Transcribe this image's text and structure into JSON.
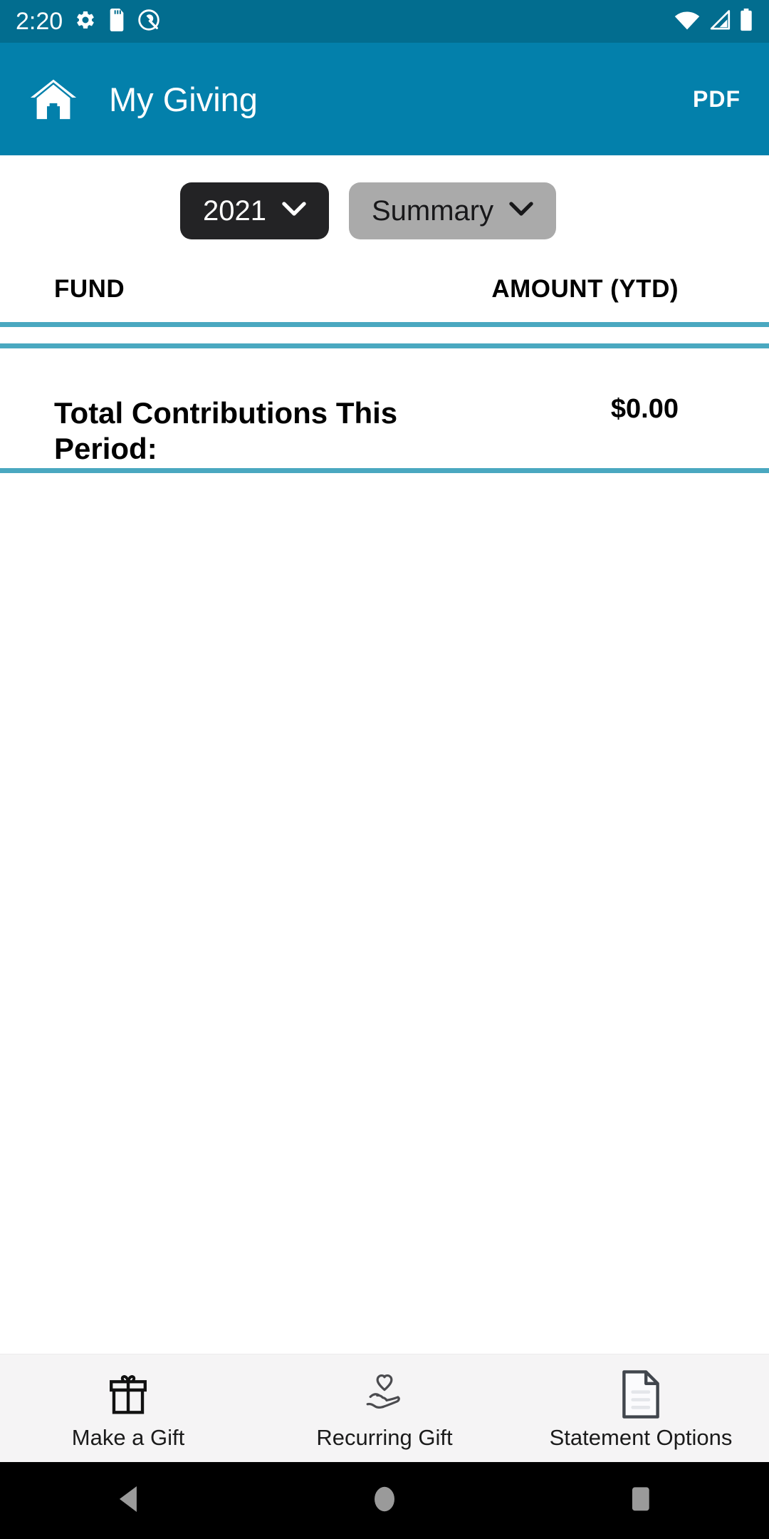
{
  "status_bar": {
    "time": "2:20",
    "left_icons": [
      "gear-icon",
      "sd-card-icon",
      "android-q-icon"
    ],
    "right_icons": [
      "wifi-icon",
      "cell-signal-icon",
      "battery-icon"
    ],
    "background_color": "#026d8f"
  },
  "app_bar": {
    "home_icon": "home-icon",
    "title": "My Giving",
    "action_label": "PDF",
    "background_color": "#0380ab"
  },
  "filters": {
    "year": {
      "label": "2021",
      "icon": "chevron-down-icon",
      "background_color": "#232325",
      "text_color": "#ffffff"
    },
    "view": {
      "label": "Summary",
      "icon": "chevron-down-icon",
      "background_color": "#aaaaaa",
      "text_color": "#18181a"
    }
  },
  "table": {
    "columns": [
      "FUND",
      "AMOUNT (YTD)"
    ],
    "rows": [],
    "divider_color": "#4aa8c0",
    "total": {
      "label": "Total Contributions This Period:",
      "amount": "$0.00"
    }
  },
  "bottom_bar": {
    "items": [
      {
        "label": "Make a Gift",
        "icon": "gift-box-icon"
      },
      {
        "label": "Recurring Gift",
        "icon": "hand-heart-icon"
      },
      {
        "label": "Statement Options",
        "icon": "document-icon"
      }
    ],
    "background_color": "#f5f4f5"
  },
  "nav_bar": {
    "buttons": [
      {
        "name": "back",
        "icon": "back-triangle-icon"
      },
      {
        "name": "home",
        "icon": "home-circle-icon"
      },
      {
        "name": "recents",
        "icon": "recents-square-icon"
      }
    ],
    "background_color": "#000000",
    "icon_color": "#9a9a9a"
  }
}
